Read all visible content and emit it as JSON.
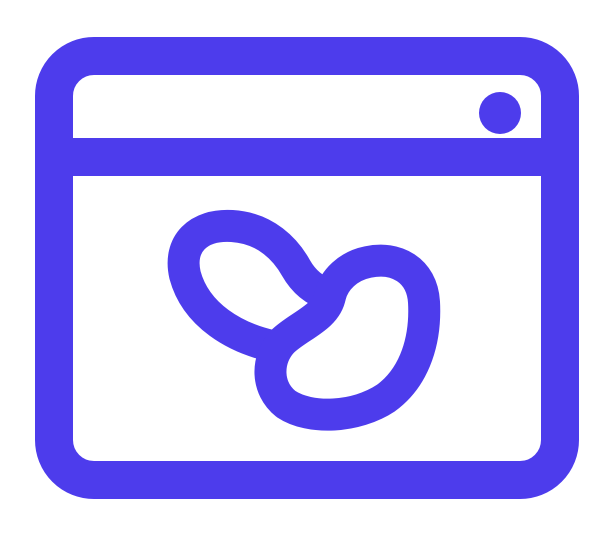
{
  "icon": {
    "name": "browser-window-beans-icon",
    "accent_color": "#4d3cec",
    "background_color": "#ffffff",
    "parts": [
      "browser-window",
      "title-bar",
      "window-dot",
      "beans"
    ]
  }
}
